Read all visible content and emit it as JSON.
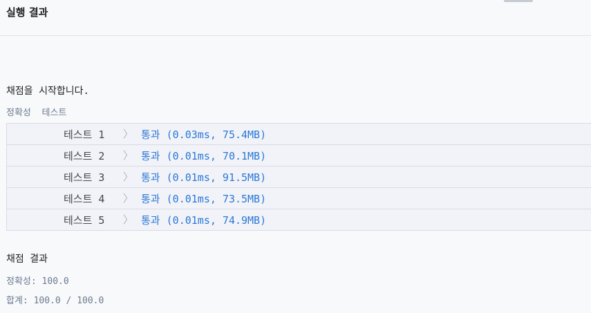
{
  "header": {
    "title": "실행 결과"
  },
  "output": {
    "start_message": "채점을 시작합니다.",
    "section_label": "정확성  테스트",
    "tests": [
      {
        "name": "테스트 1",
        "result": "통과 (0.03ms, 75.4MB)"
      },
      {
        "name": "테스트 2",
        "result": "통과 (0.01ms, 70.1MB)"
      },
      {
        "name": "테스트 3",
        "result": "통과 (0.01ms, 91.5MB)"
      },
      {
        "name": "테스트 4",
        "result": "통과 (0.01ms, 73.5MB)"
      },
      {
        "name": "테스트 5",
        "result": "통과 (0.01ms, 74.9MB)"
      }
    ],
    "chevron": "〉",
    "score_title": "채점 결과",
    "accuracy_label": "정확성: ",
    "accuracy_value": "100.0",
    "total_label": "합계: ",
    "total_value": "100.0 / 100.0"
  },
  "colors": {
    "pass": "#2b78d6",
    "muted": "#6b7a8f",
    "background": "#f8f9fb"
  }
}
